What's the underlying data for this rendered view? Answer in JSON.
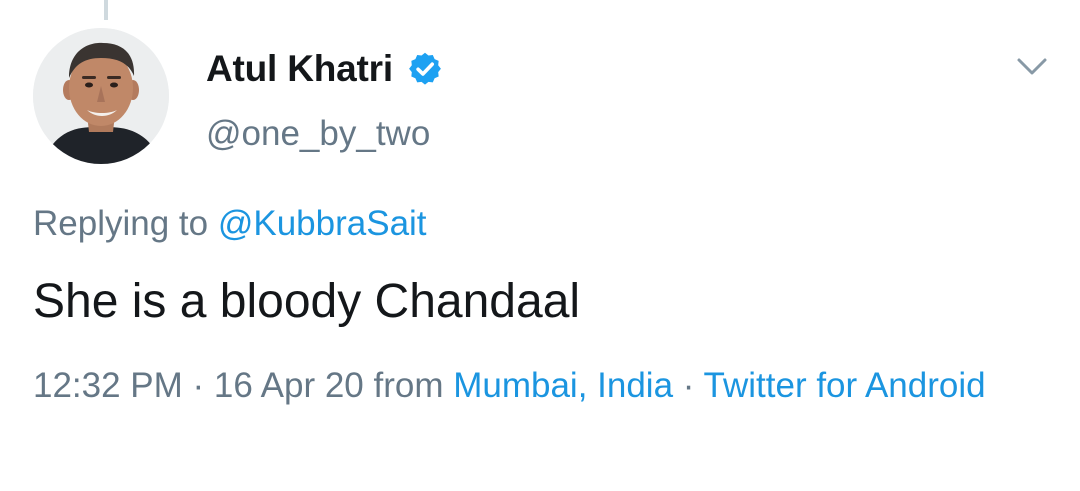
{
  "author": {
    "name": "Atul Khatri",
    "handle": "@one_by_two"
  },
  "reply": {
    "prefix": "Replying to ",
    "mention": "@KubbraSait"
  },
  "tweet": {
    "text": "She is a bloody Chandaal"
  },
  "meta": {
    "time": "12:32 PM",
    "separator": " · ",
    "date": "16 Apr 20",
    "from_label": " from ",
    "location": "Mumbai, India",
    "separator2": " · ",
    "source": "Twitter for Android"
  },
  "icons": {
    "verified": "verified-badge-icon",
    "menu": "chevron-down-icon"
  },
  "colors": {
    "link": "#1b95e0",
    "secondary_text": "#657786",
    "primary_text": "#14171a",
    "verified": "#1da1f2"
  }
}
